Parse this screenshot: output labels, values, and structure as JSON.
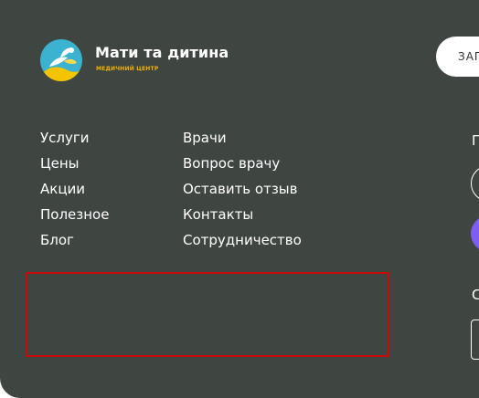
{
  "brand": {
    "name": "Мати та дитина",
    "subtitle": "медичний центр",
    "logo_icon": "stork-logo-icon",
    "accent_color": "#f2b300"
  },
  "header": {
    "cta_label": "ЗАП"
  },
  "nav": {
    "column1": [
      "Услуги",
      "Цены",
      "Акции",
      "Полезное",
      "Блог"
    ],
    "column2": [
      "Врачи",
      "Вопрос врачу",
      "Оставить отзыв",
      "Контакты",
      "Сотрудничество"
    ]
  },
  "right": {
    "label1": "П",
    "label2": "С"
  },
  "colors": {
    "footer_bg": "#3f4642",
    "highlight_border": "#c60a0a",
    "purple_button": "#7b5ff0"
  }
}
